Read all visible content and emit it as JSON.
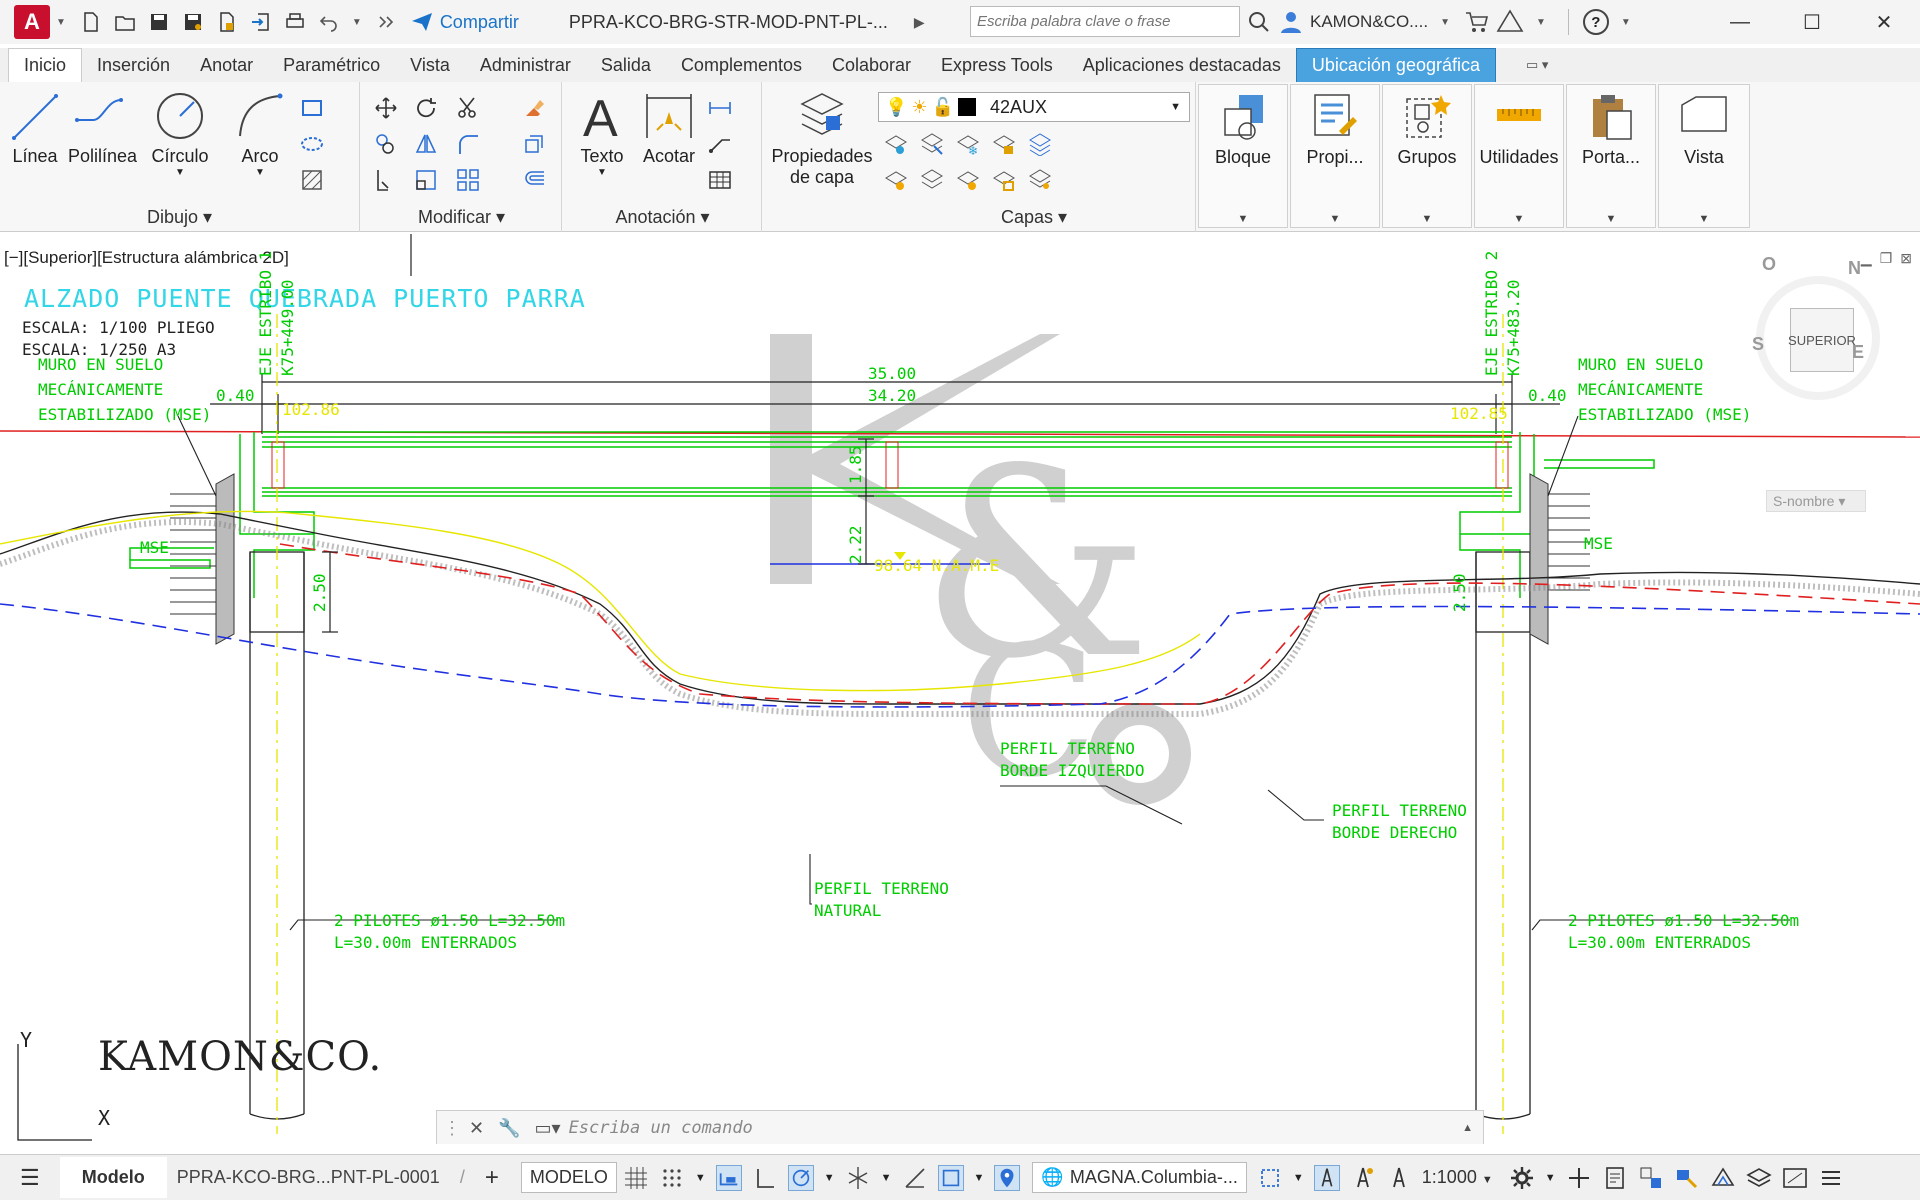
{
  "titlebar": {
    "app_letter": "A",
    "share_label": "Compartir",
    "document_title": "PPRA-KCO-BRG-STR-MOD-PNT-PL-...",
    "search_placeholder": "Escriba palabra clave o frase",
    "user_name": "KAMON&CO....",
    "help_label": "?"
  },
  "ribbon_tabs": [
    "Inicio",
    "Inserción",
    "Anotar",
    "Paramétrico",
    "Vista",
    "Administrar",
    "Salida",
    "Complementos",
    "Colaborar",
    "Express Tools",
    "Aplicaciones destacadas",
    "Ubicación geográfica"
  ],
  "ribbon": {
    "dibujo": {
      "label": "Dibujo",
      "tools": [
        "Línea",
        "Polilínea",
        "Círculo",
        "Arco"
      ]
    },
    "modificar": {
      "label": "Modificar"
    },
    "anotacion": {
      "label": "Anotación",
      "tools": [
        "Texto",
        "Acotar"
      ]
    },
    "capas": {
      "label": "Capas",
      "prop_line1": "Propiedades",
      "prop_line2": "de capa",
      "current_layer": "42AUX"
    },
    "panels": [
      "Bloque",
      "Propi...",
      "Grupos",
      "Utilidades",
      "Porta...",
      "Vista"
    ]
  },
  "viewport": {
    "label": "[−][Superior][Estructura alámbrica 2D]",
    "viewcube_face": "SUPERIOR",
    "compass": {
      "n": "N",
      "s": "S",
      "e": "E",
      "o": "O"
    },
    "named_view": "S-nombre"
  },
  "drawing": {
    "title": "ALZADO PUENTE QUEBRADA PUERTO PARRA",
    "scale1": "ESCALA: 1/100 PLIEGO",
    "scale2": "ESCALA: 1/250 A3",
    "eje1_line1": "EJE ESTRIBO 1",
    "eje1_line2": "K75+449.00",
    "eje2_line1": "EJE ESTRIBO 2",
    "eje2_line2": "K75+483.20",
    "mse_left": [
      "MURO EN SUELO",
      "MECÁNICAMENTE",
      "ESTABILIZADO (MSE)"
    ],
    "mse_right": [
      "MURO EN SUELO",
      "MECÁNICAMENTE",
      "ESTABILIZADO (MSE)"
    ],
    "dim_total": "35.00",
    "dim_span": "34.20",
    "dim_left_offset": "0.40",
    "dim_right_offset": "0.40",
    "elev_left": "102.86",
    "elev_right": "102.85",
    "dim_depth": "1.85",
    "dim_clearance": "2.22",
    "dim_pile_cap": "2.50",
    "dim_pile_cap_right": "2.50",
    "water_level": "98.64 N.A.M.E",
    "mse_tag_left": "MSE",
    "mse_tag_right": "MSE",
    "terrain_left": [
      "PERFIL TERRENO",
      "BORDE IZQUIERDO"
    ],
    "terrain_right": [
      "PERFIL TERRENO",
      "BORDE DERECHO"
    ],
    "terrain_natural": [
      "PERFIL TERRENO",
      "NATURAL"
    ],
    "piles_left": [
      "2 PILOTES ø1.50 L=32.50m",
      "L=30.00m ENTERRADOS"
    ],
    "piles_right": [
      "2 PILOTES ø1.50 L=32.50m",
      "L=30.00m ENTERRADOS"
    ],
    "brand": "KAMON&CO.",
    "ucs_y": "Y",
    "ucs_x": "X"
  },
  "command_line": {
    "placeholder": "Escriba un comando"
  },
  "statusbar": {
    "model_tab": "Modelo",
    "layout_tab": "PPRA-KCO-BRG...PNT-PL-0001",
    "add_tab": "+",
    "space": "MODELO",
    "coord_system": "MAGNA.Columbia-...",
    "scale": "1:1000"
  },
  "colors": {
    "cad_green": "#00cc00",
    "cad_cyan": "#33d6e6",
    "cad_yellow": "#e6e600",
    "cad_red": "#e02020",
    "cad_blue": "#2030e0",
    "accent_tab": "#4aa3df",
    "watermark": "#c8c8c8"
  }
}
